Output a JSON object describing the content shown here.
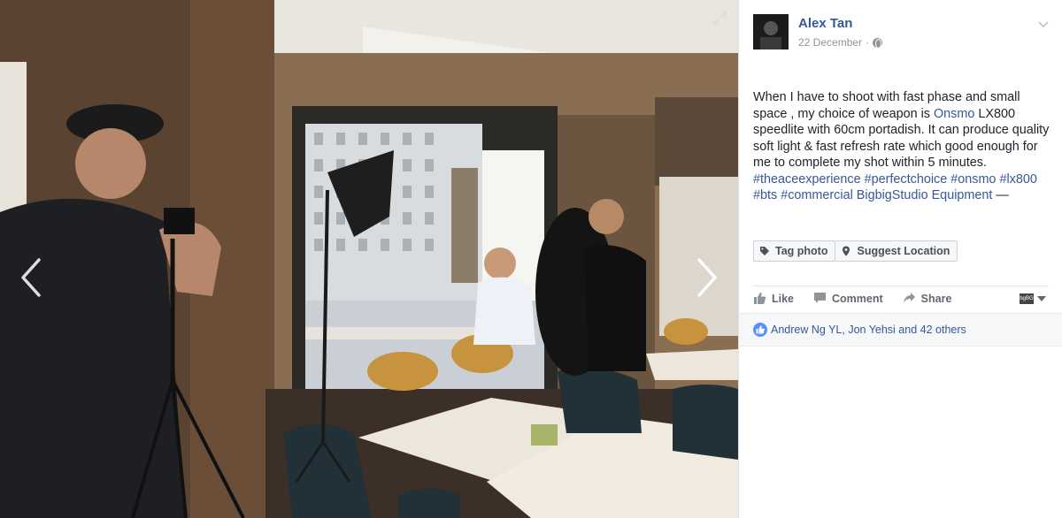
{
  "post": {
    "author": "Alex Tan",
    "date": "22 December",
    "separator": "·",
    "text_parts": {
      "p1": "When I have to shoot with fast phase and small space , my choice of weapon is ",
      "link_onsmo": "Onsmo",
      "p2": " LX800 speedlite with 60cm portadish. It can produce quality soft light & fast refresh rate which good enough for me to complete my shot within 5 minutes. ",
      "tag1": "#theaceexperience",
      "tag2": "#perfectchoice",
      "tag3": "#onsmo",
      "tag4": "#lx800",
      "tag5": "#bts",
      "tag6": "#commercial",
      "page_link": "BigbigStudio Equipment",
      "p3": " —"
    }
  },
  "buttons": {
    "tag_photo": "Tag photo",
    "suggest_location": "Suggest Location"
  },
  "actions": {
    "like": "Like",
    "comment": "Comment",
    "share": "Share",
    "audience_avatar_text": "bgBG"
  },
  "likes": {
    "text": "Andrew Ng YL, Jon Yehsi and 42 others"
  },
  "icons": {
    "prev": "chevron-left-icon",
    "next": "chevron-right-icon",
    "expand": "expand-icon",
    "privacy": "globe-icon",
    "options": "chevron-down-icon",
    "tag": "tag-icon",
    "location": "location-pin-icon",
    "like": "thumbs-up-icon",
    "comment": "comment-icon",
    "share": "share-icon",
    "like_badge": "like-badge-icon"
  },
  "colors": {
    "link": "#365899",
    "like_badge": "#5890ff",
    "muted": "#90949c"
  }
}
